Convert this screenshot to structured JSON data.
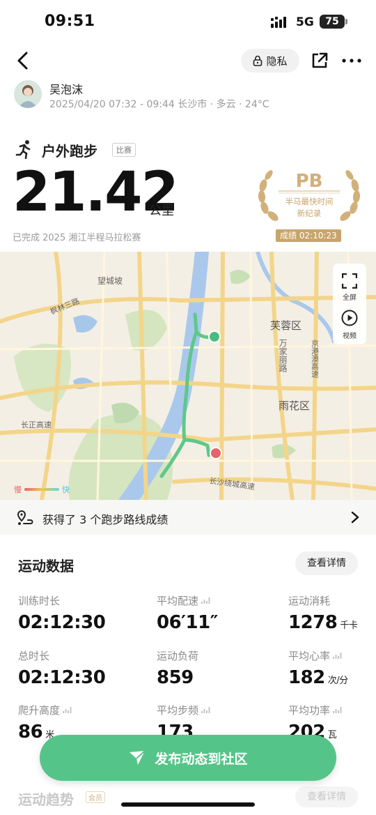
{
  "status_bar": {
    "time": "09:51",
    "network": "5G",
    "battery": "75"
  },
  "header": {
    "privacy_label": "隐私"
  },
  "user": {
    "name": "吴泡沫",
    "meta": "2025/04/20 07:32 - 09:44 长沙市 · 多云 · 24°C"
  },
  "activity": {
    "sport": "户外跑步",
    "race_tag": "比赛",
    "distance": "21.42",
    "distance_unit": "公里",
    "completed_text": "已完成 2025 湘江半程马拉松赛",
    "pb": {
      "title": "PB",
      "line1": "半马最快时间",
      "line2": "新纪录",
      "result": "成绩 02:10:23"
    }
  },
  "map": {
    "labels": {
      "wangchengpo": "望城坡",
      "fenglin": "枫林三路",
      "furong": "芙蓉区",
      "wanjiali": "万家丽路",
      "jinggang": "京港澳高速",
      "yuhua": "雨花区",
      "changzhi": "长正高速",
      "raocheng": "长沙绕城高速"
    },
    "fullscreen_label": "全屏",
    "video_label": "视频",
    "speed_slow": "慢",
    "speed_fast": "快",
    "route_color": "#5fc78b",
    "start_color": "#4cbb7f",
    "end_color": "#e8636a"
  },
  "achievement": {
    "text": "获得了 3 个跑步路线成绩"
  },
  "sport_data": {
    "title": "运动数据",
    "detail_button": "查看详情",
    "metrics": [
      {
        "label": "训练时长",
        "value": "02:12:30",
        "unit": ""
      },
      {
        "label": "平均配速",
        "value": "06′11″",
        "unit": ""
      },
      {
        "label": "运动消耗",
        "value": "1278",
        "unit": "千卡"
      },
      {
        "label": "总时长",
        "value": "02:12:30",
        "unit": ""
      },
      {
        "label": "运动负荷",
        "value": "859",
        "unit": ""
      },
      {
        "label": "平均心率",
        "value": "182",
        "unit": "次/分"
      },
      {
        "label": "爬升高度",
        "value": "86",
        "unit": "米"
      },
      {
        "label": "平均步频",
        "value": "173",
        "unit": ""
      },
      {
        "label": "平均功率",
        "value": "202",
        "unit": "瓦"
      }
    ]
  },
  "fab": {
    "label": "发布动态到社区"
  },
  "trend": {
    "title": "运动趋势",
    "vip_tag": "会员",
    "detail_button": "查看详情"
  },
  "colors": {
    "accent_green": "#55c488",
    "gold": "#c9a46a"
  }
}
